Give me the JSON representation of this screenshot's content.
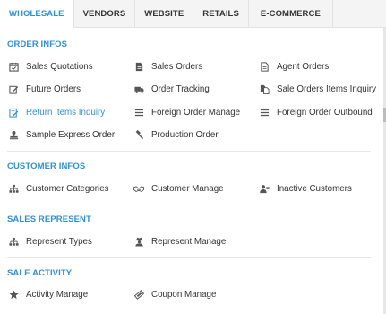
{
  "tabs": [
    {
      "label": "WHOLESALE",
      "active": true
    },
    {
      "label": "VENDORS"
    },
    {
      "label": "WEBSITE"
    },
    {
      "label": "RETAILS"
    },
    {
      "label": "E-COMMERCE"
    }
  ],
  "colors": {
    "accent": "#2f8fd8",
    "icon": "#555555"
  },
  "sections": {
    "order_infos": {
      "title": "ORDER INFOS",
      "items": [
        {
          "label": "Sales Quotations",
          "icon": "calendar-check-icon"
        },
        {
          "label": "Sales Orders",
          "icon": "document-icon"
        },
        {
          "label": "Agent Orders",
          "icon": "document-outline-icon"
        },
        {
          "label": "Future Orders",
          "icon": "edit-icon"
        },
        {
          "label": "Order Tracking",
          "icon": "truck-icon"
        },
        {
          "label": "Sale Orders Items Inquiry",
          "icon": "copy-icon"
        },
        {
          "label": "Return Items Inquiry",
          "icon": "document-edit-icon",
          "highlighted": true
        },
        {
          "label": "Foreign Order Manage",
          "icon": "list-icon"
        },
        {
          "label": "Foreign Order Outbound",
          "icon": "list-icon"
        },
        {
          "label": "Sample Express Order",
          "icon": "stamp-icon"
        },
        {
          "label": "Production Order",
          "icon": "gavel-icon"
        }
      ]
    },
    "customer_infos": {
      "title": "CUSTOMER INFOS",
      "items": [
        {
          "label": "Customer Categories",
          "icon": "sitemap-icon"
        },
        {
          "label": "Customer Manage",
          "icon": "handshake-icon"
        },
        {
          "label": "Inactive Customers",
          "icon": "user-times-icon"
        }
      ]
    },
    "sales_represent": {
      "title": "SALES REPRESENT",
      "items": [
        {
          "label": "Represent Types",
          "icon": "sitemap-icon"
        },
        {
          "label": "Represent Manage",
          "icon": "user-secret-icon"
        }
      ]
    },
    "sale_activity": {
      "title": "SALE ACTIVITY",
      "items": [
        {
          "label": "Activity Manage",
          "icon": "star-icon"
        },
        {
          "label": "Coupon Manage",
          "icon": "ticket-icon"
        }
      ]
    }
  }
}
